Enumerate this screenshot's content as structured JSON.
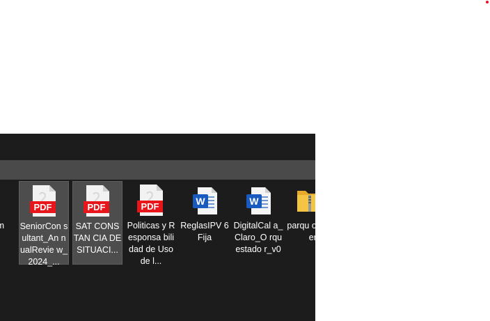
{
  "files": [
    {
      "name": "partial-pdf-left",
      "type": "pdf",
      "label": "m",
      "selected": false
    },
    {
      "name": "pdf-senior-consultant",
      "type": "pdf",
      "label": "SeniorCon sultant_An nualRevie w_2024_...",
      "selected": true
    },
    {
      "name": "pdf-sat-constancia",
      "type": "pdf",
      "label": "SAT CONSTAN CIA DE SITUACI...",
      "selected": true
    },
    {
      "name": "pdf-politicas",
      "type": "pdf",
      "label": "Politicas y Responsa bilidad de Uso de l...",
      "selected": false
    },
    {
      "name": "word-reglas-ipv6",
      "type": "word",
      "label": "ReglasIPV 6Fija",
      "selected": false
    },
    {
      "name": "word-digital-cala",
      "type": "word",
      "label": "DigitalCal a_Claro_O rquestado r_v0",
      "selected": false
    },
    {
      "name": "zip-parque",
      "type": "zip",
      "label": "parqu onvert y",
      "selected": false
    }
  ],
  "icon_labels": {
    "pdf": "PDF",
    "word": "W"
  },
  "colors": {
    "pdf_red": "#e8161b",
    "word_blue": "#185abd",
    "zip_yellow": "#f4c542",
    "background": "#1c1c1c"
  }
}
